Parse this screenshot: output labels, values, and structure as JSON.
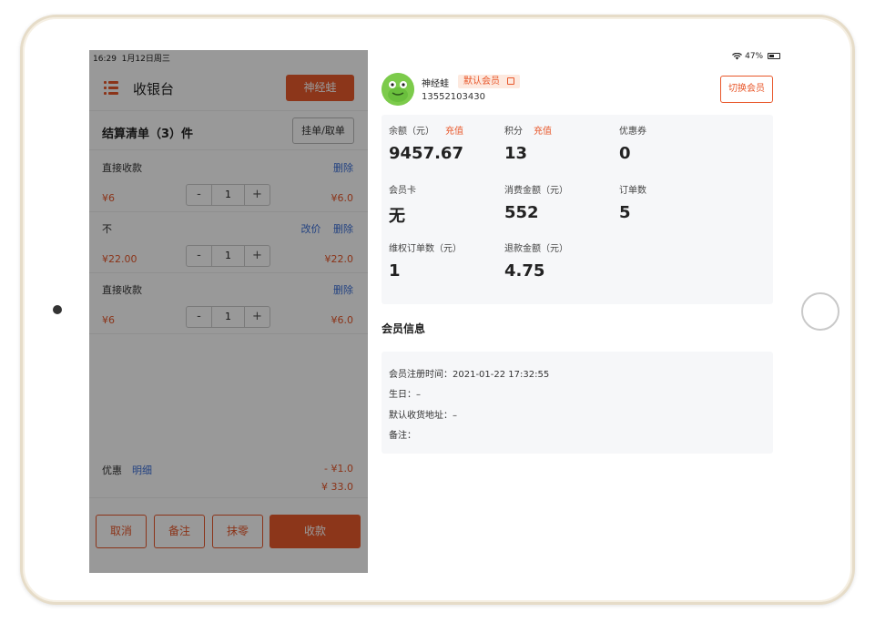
{
  "status": {
    "time": "16:29",
    "date": "1月12日周三",
    "battery": "47%"
  },
  "left": {
    "title": "收银台",
    "member_button": "神经蛙",
    "summary_title": "结算清单（3）件",
    "hold_button": "挂单/取单",
    "items": [
      {
        "name": "直接收款",
        "actions": [
          "删除"
        ],
        "price": "¥6",
        "qty": "1",
        "total": "¥6.0"
      },
      {
        "name": "不",
        "actions": [
          "改价",
          "删除"
        ],
        "price": "¥22.00",
        "qty": "1",
        "total": "¥22.0"
      },
      {
        "name": "直接收款",
        "actions": [
          "删除"
        ],
        "price": "¥6",
        "qty": "1",
        "total": "¥6.0"
      }
    ],
    "stepper": {
      "minus": "-",
      "plus": "+"
    },
    "discount": {
      "label": "优惠",
      "link": "明细",
      "amount": "- ¥1.0",
      "total": "¥ 33.0"
    },
    "buttons": {
      "cancel": "取消",
      "note": "备注",
      "round": "抹零",
      "pay": "收款"
    }
  },
  "member": {
    "name": "神经蛙",
    "badge": "默认会员",
    "phone": "13552103430",
    "switch_button": "切换会员",
    "stats": [
      {
        "label": "余额（元）",
        "link": "充值",
        "value": "9457.67"
      },
      {
        "label": "积分",
        "link": "充值",
        "value": "13"
      },
      {
        "label": "优惠券",
        "link": "",
        "value": "0"
      },
      {
        "label": "会员卡",
        "link": "",
        "value": "无"
      },
      {
        "label": "消费金额（元）",
        "link": "",
        "value": "552"
      },
      {
        "label": "订单数",
        "link": "",
        "value": "5"
      },
      {
        "label": "维权订单数（元）",
        "link": "",
        "value": "1"
      },
      {
        "label": "退款金额（元）",
        "link": "",
        "value": "4.75"
      }
    ],
    "info_title": "会员信息",
    "info": {
      "register": "会员注册时间：2021-01-22 17:32:55",
      "birthday": "生日：–",
      "address": "默认收货地址：–",
      "remark": "备注："
    }
  },
  "colors": {
    "accent": "#ea5a2c",
    "link": "#3b6fd8"
  }
}
